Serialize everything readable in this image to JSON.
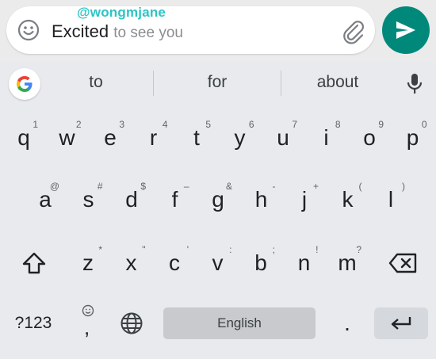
{
  "compose": {
    "typed_text": "Excited",
    "suggestion_text": "to see you",
    "watermark": "@wongmjane",
    "icons": {
      "emoji": "smiley-face-icon",
      "attach": "paperclip-icon",
      "send": "send-arrow-icon"
    },
    "send_color": "#00897b"
  },
  "suggestions": {
    "items": [
      "to",
      "for",
      "about"
    ],
    "icons": {
      "logo": "google-g-icon",
      "voice": "microphone-icon"
    }
  },
  "keyboard": {
    "row1": [
      {
        "key": "q",
        "hint": "1"
      },
      {
        "key": "w",
        "hint": "2"
      },
      {
        "key": "e",
        "hint": "3"
      },
      {
        "key": "r",
        "hint": "4"
      },
      {
        "key": "t",
        "hint": "5"
      },
      {
        "key": "y",
        "hint": "6"
      },
      {
        "key": "u",
        "hint": "7"
      },
      {
        "key": "i",
        "hint": "8"
      },
      {
        "key": "o",
        "hint": "9"
      },
      {
        "key": "p",
        "hint": "0"
      }
    ],
    "row2": [
      {
        "key": "a",
        "hint": "@"
      },
      {
        "key": "s",
        "hint": "#"
      },
      {
        "key": "d",
        "hint": "$"
      },
      {
        "key": "f",
        "hint": "–"
      },
      {
        "key": "g",
        "hint": "&"
      },
      {
        "key": "h",
        "hint": "-"
      },
      {
        "key": "j",
        "hint": "+"
      },
      {
        "key": "k",
        "hint": "("
      },
      {
        "key": "l",
        "hint": ")"
      }
    ],
    "row3": [
      {
        "key": "z",
        "hint": "*"
      },
      {
        "key": "x",
        "hint": "\""
      },
      {
        "key": "c",
        "hint": "'"
      },
      {
        "key": "v",
        "hint": ":"
      },
      {
        "key": "b",
        "hint": ";"
      },
      {
        "key": "n",
        "hint": "!"
      },
      {
        "key": "m",
        "hint": "?"
      }
    ],
    "bottom": {
      "symbols_label": "?123",
      "comma_label": ",",
      "comma_hint_icon": "emoji-icon",
      "space_label": "English",
      "period_label": "."
    },
    "icons": {
      "shift": "shift-arrow-icon",
      "backspace": "backspace-icon",
      "language": "globe-icon",
      "enter": "enter-return-icon"
    }
  }
}
